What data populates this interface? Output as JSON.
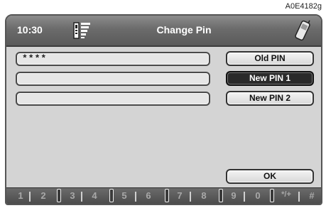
{
  "figure_ref": "A0E4182g",
  "header": {
    "time": "10:30",
    "title": "Change Pin"
  },
  "fields": [
    {
      "value": "****"
    },
    {
      "value": ""
    },
    {
      "value": ""
    }
  ],
  "buttons": {
    "old_pin": "Old PIN",
    "new_pin_1": "New PIN 1",
    "new_pin_2": "New PIN 2",
    "ok": "OK"
  },
  "selected_button": "New PIN 1",
  "keypad": {
    "keys": [
      "1",
      "2",
      "3",
      "4",
      "5",
      "6",
      "7",
      "8",
      "9",
      "0",
      "*/+",
      "#"
    ]
  },
  "icons": {
    "signal": "signal-strength-icon",
    "phone": "mobile-phone-icon"
  },
  "colors": {
    "header": "#6b6b6b",
    "background": "#d4d4d4",
    "selected_button": "#2a2a2a"
  }
}
